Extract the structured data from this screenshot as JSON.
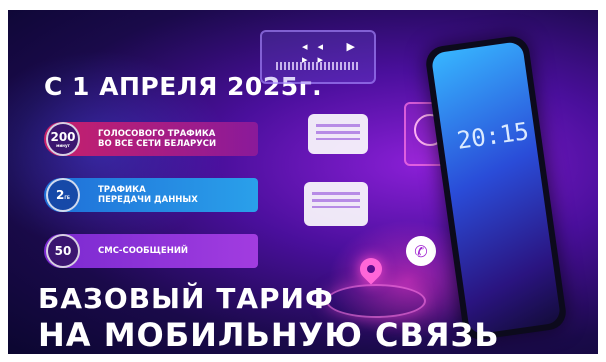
{
  "headline_date": "С 1 АПРЕЛЯ 2025г.",
  "benefits": [
    {
      "number": "200",
      "unit": "минут",
      "line1": "ГОЛОСОВОГО ТРАФИКА",
      "line2": "ВО ВСЕ СЕТИ БЕЛАРУСИ"
    },
    {
      "number": "2",
      "unit": "ГБ",
      "line1": "ТРАФИКА",
      "line2": "ПЕРЕДАЧИ ДАННЫХ"
    },
    {
      "number": "50",
      "unit": "",
      "line1": "СМС-СООБЩЕНИЙ",
      "line2": ""
    }
  ],
  "title_line1": "БАЗОВЫЙ ТАРИФ",
  "title_line2": "НА МОБИЛЬНУЮ СВЯЗЬ",
  "phone_clock": "20:15",
  "media_controls": "◂◂ ▶ ▸▸",
  "colors": {
    "accent": "#ff4ccf",
    "bg_dark": "#0b0630",
    "bg_purple": "#4a0f9c"
  },
  "icons": [
    "play-icon",
    "profile-icon",
    "phone-call-icon",
    "location-pin-icon",
    "chat-icon"
  ]
}
